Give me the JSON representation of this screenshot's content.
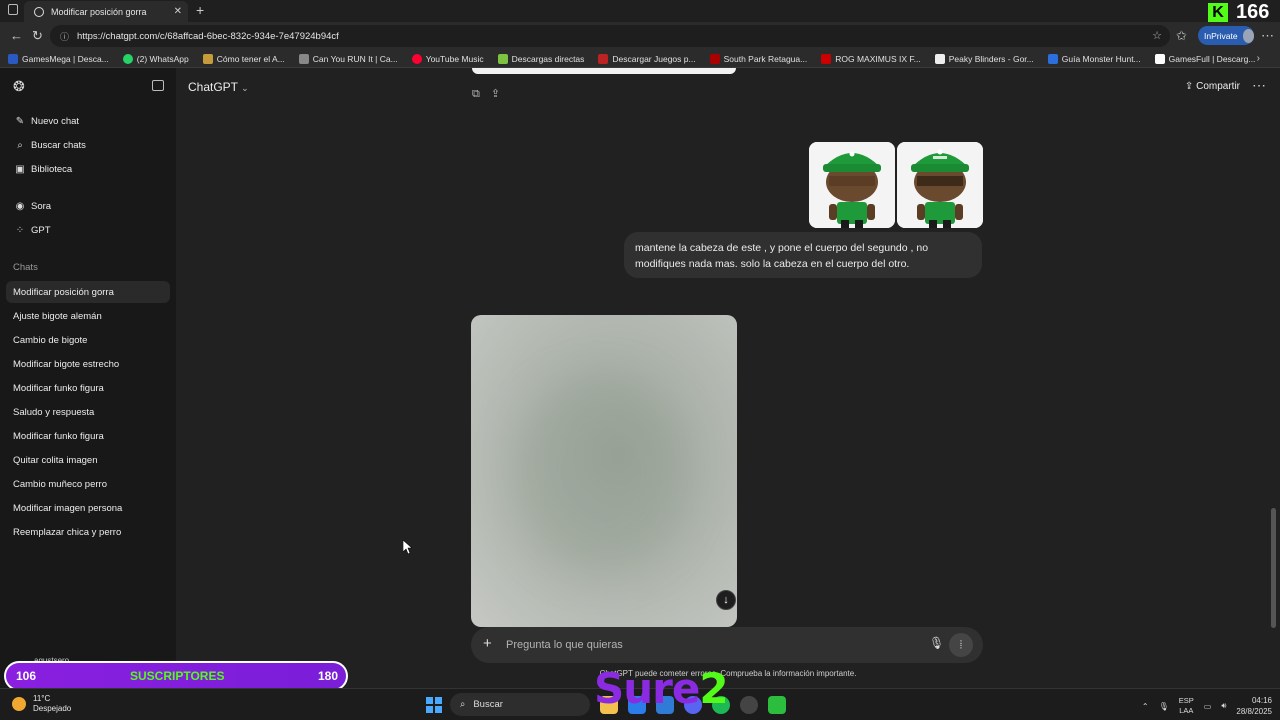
{
  "browser": {
    "tab_title": "Modificar posición gorra",
    "url": "https://chatgpt.com/c/68affcad-6bec-832c-934e-7e47924b94cf",
    "inprivate_label": "InPrivate",
    "kick_counter": "166",
    "bookmarks": [
      "GamesMega | Desca...",
      "(2) WhatsApp",
      "Cómo tener el A...",
      "Can You RUN It | Ca...",
      "YouTube Music",
      "Descargas directas",
      "Descargar Juegos p...",
      "South Park Retagua...",
      "ROG MAXIMUS IX F...",
      "Peaky Blinders - Gor...",
      "Guía Monster Hunt...",
      "GamesFull | Descarg..."
    ]
  },
  "sidebar": {
    "nav": [
      {
        "label": "Nuevo chat",
        "icon": "edit-icon"
      },
      {
        "label": "Buscar chats",
        "icon": "search-icon"
      },
      {
        "label": "Biblioteca",
        "icon": "library-icon"
      },
      {
        "label": "Sora",
        "icon": "sora-icon"
      },
      {
        "label": "GPT",
        "icon": "gpt-grid-icon"
      }
    ],
    "section_label": "Chats",
    "chats": [
      "Modificar posición gorra",
      "Ajuste bigote alemán",
      "Cambio de bigote",
      "Modificar bigote estrecho",
      "Modificar funko figura",
      "Saludo y respuesta",
      "Modificar funko figura",
      "Quitar colita imagen",
      "Cambio muñeco perro",
      "Modificar imagen persona",
      "Reemplazar chica y perro"
    ],
    "user_name": "agustsero"
  },
  "main": {
    "model_label": "ChatGPT",
    "share_label": "Compartir",
    "user_message": "mantene la cabeza de este , y pone el cuerpo del segundo , no modifiques nada mas. solo la cabeza en el cuerpo del otro.",
    "composer_placeholder": "Pregunta lo que quieras",
    "disclaimer": "ChatGPT puede cometer errores. Comprueba la información importante."
  },
  "overlay": {
    "sub_left": "106",
    "sub_center": "SUSCRIPTORES",
    "sub_right": "180",
    "brand_text": "Sure",
    "brand_digit": "2"
  },
  "taskbar": {
    "temperature": "11°C",
    "weather": "Despejado",
    "search_label": "Buscar",
    "lang_line1": "ESP",
    "lang_line2": "LAA",
    "time": "04:16",
    "date": "28/8/2025"
  },
  "colors": {
    "accent_kick": "#53fc18",
    "sub_bar": "#8a1fe0",
    "inprivate": "#2a5db0"
  }
}
